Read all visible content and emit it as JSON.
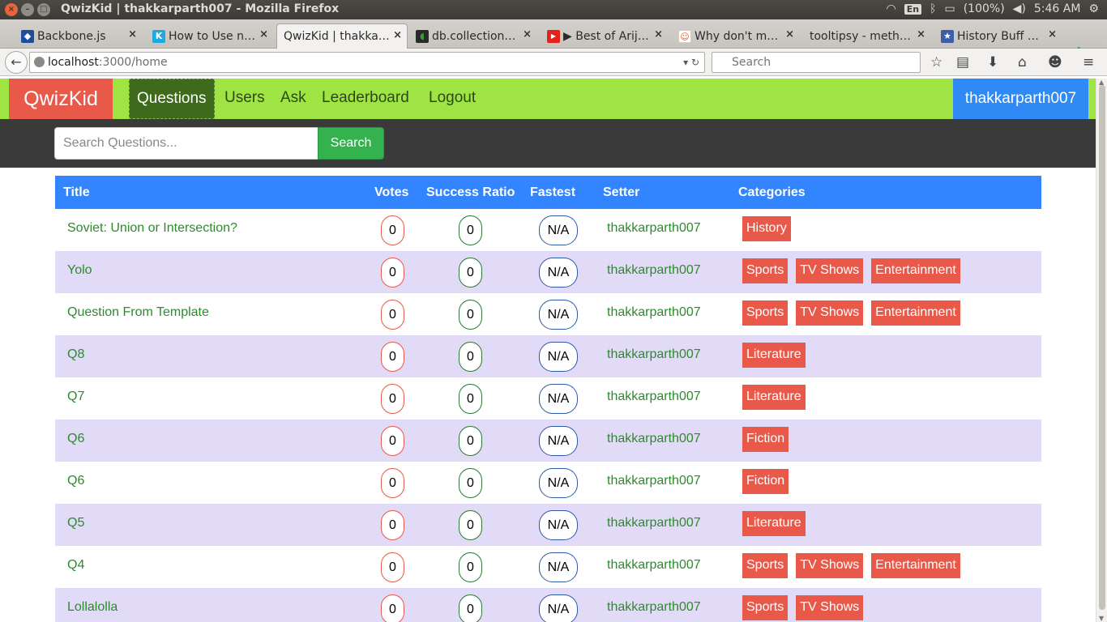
{
  "os": {
    "window_title": "QwizKid | thakkarparth007 - Mozilla Firefox",
    "lang": "En",
    "battery": "(100%)",
    "time": "5:46 AM"
  },
  "browser": {
    "tabs": [
      {
        "label": "Backbone.js",
        "icon": "backbone-icon",
        "color": "#1b4f9c",
        "glyph": "◆"
      },
      {
        "label": "How to Use n…",
        "icon": "k-icon",
        "color": "#1fa9e1",
        "glyph": "K"
      },
      {
        "label": "QwizKid | thakka…",
        "icon": "",
        "color": "",
        "glyph": ""
      },
      {
        "label": "db.collection…",
        "icon": "mongodb-leaf-icon",
        "color": "#3f9c35",
        "glyph": "◖"
      },
      {
        "label": "▶ Best of Arij…",
        "icon": "youtube-icon",
        "color": "#e62117",
        "glyph": "▶"
      },
      {
        "label": "Why don't m…",
        "icon": "reddit-icon",
        "color": "#ff5700",
        "glyph": "☺"
      },
      {
        "label": "tooltipsy - meth…",
        "icon": "",
        "color": "",
        "glyph": ""
      },
      {
        "label": "History Buff …",
        "icon": "history-buff-icon",
        "color": "#3b5ea8",
        "glyph": "★"
      }
    ],
    "url_host": "localhost",
    "url_path": ":3000/home",
    "search_placeholder": "Search"
  },
  "app": {
    "brand": "QwizKid",
    "nav": [
      "Questions",
      "Users",
      "Ask",
      "Leaderboard",
      "Logout"
    ],
    "user": "thakkarparth007",
    "search_placeholder": "Search Questions...",
    "search_button": "Search",
    "columns": {
      "title": "Title",
      "votes": "Votes",
      "ratio": "Success Ratio",
      "fastest": "Fastest",
      "setter": "Setter",
      "categories": "Categories"
    },
    "rows": [
      {
        "title": "Soviet: Union or Intersection?",
        "votes": "0",
        "ratio": "0",
        "fastest": "N/A",
        "setter": "thakkarparth007",
        "categories": [
          "History"
        ]
      },
      {
        "title": "Yolo",
        "votes": "0",
        "ratio": "0",
        "fastest": "N/A",
        "setter": "thakkarparth007",
        "categories": [
          "Sports",
          "TV Shows",
          "Entertainment"
        ]
      },
      {
        "title": "Question From Template",
        "votes": "0",
        "ratio": "0",
        "fastest": "N/A",
        "setter": "thakkarparth007",
        "categories": [
          "Sports",
          "TV Shows",
          "Entertainment"
        ]
      },
      {
        "title": "Q8",
        "votes": "0",
        "ratio": "0",
        "fastest": "N/A",
        "setter": "thakkarparth007",
        "categories": [
          "Literature"
        ]
      },
      {
        "title": "Q7",
        "votes": "0",
        "ratio": "0",
        "fastest": "N/A",
        "setter": "thakkarparth007",
        "categories": [
          "Literature"
        ]
      },
      {
        "title": "Q6",
        "votes": "0",
        "ratio": "0",
        "fastest": "N/A",
        "setter": "thakkarparth007",
        "categories": [
          "Fiction"
        ]
      },
      {
        "title": "Q6",
        "votes": "0",
        "ratio": "0",
        "fastest": "N/A",
        "setter": "thakkarparth007",
        "categories": [
          "Fiction"
        ]
      },
      {
        "title": "Q5",
        "votes": "0",
        "ratio": "0",
        "fastest": "N/A",
        "setter": "thakkarparth007",
        "categories": [
          "Literature"
        ]
      },
      {
        "title": "Q4",
        "votes": "0",
        "ratio": "0",
        "fastest": "N/A",
        "setter": "thakkarparth007",
        "categories": [
          "Sports",
          "TV Shows",
          "Entertainment"
        ]
      },
      {
        "title": "Lollalolla",
        "votes": "0",
        "ratio": "0",
        "fastest": "N/A",
        "setter": "thakkarparth007",
        "categories": [
          "Sports",
          "TV Shows"
        ]
      }
    ]
  },
  "colors": {
    "navbar": "#a0e444",
    "brand": "#e9594a",
    "header": "#3385ff",
    "row_alt": "#e2dbf7",
    "link": "#2d8a2d",
    "category": "#e9594a",
    "search_button": "#33b24e"
  }
}
